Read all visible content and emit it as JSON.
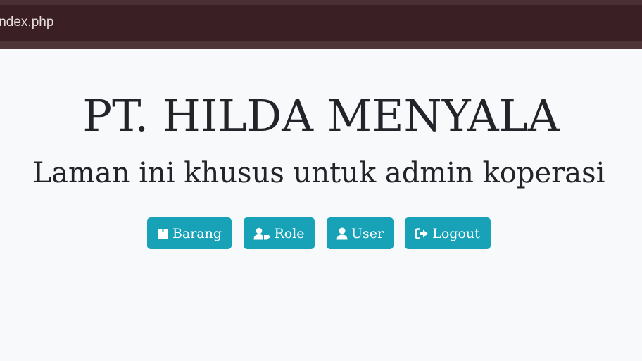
{
  "browser": {
    "address": "index.php"
  },
  "header": {
    "title": "PT. HILDA MENYALA",
    "subtitle": "Laman ini khusus untuk admin koperasi"
  },
  "nav": {
    "buttons": [
      {
        "label": "Barang",
        "icon": "box-icon"
      },
      {
        "label": "Role",
        "icon": "user-role-icon"
      },
      {
        "label": "User",
        "icon": "user-icon"
      },
      {
        "label": "Logout",
        "icon": "logout-icon"
      }
    ],
    "button_color": "#17a2b8"
  }
}
